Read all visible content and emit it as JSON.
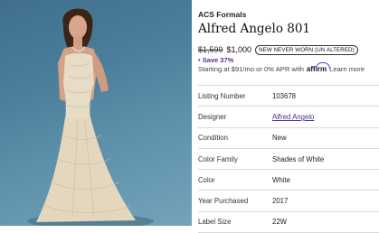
{
  "photo": {
    "alt": "wedding-dress-photo"
  },
  "listing": {
    "brand": "ACS Formals",
    "title": "Alfred Angelo 801",
    "original_price": "$1,599",
    "price": "$1,000",
    "condition_badge": "NEW NEVER WORN (UN ALTERED)",
    "savings": "• Save 37%",
    "financing_prefix": "Starting at $91/mo or 0% APR with",
    "affirm_label": "affirm",
    "learn_more": "Learn more"
  },
  "details": [
    {
      "label": "Listing Number",
      "value": "103678",
      "link": false
    },
    {
      "label": "Designer",
      "value": "Alfred Angelo",
      "link": true
    },
    {
      "label": "Condition",
      "value": "New",
      "link": false
    },
    {
      "label": "Color Family",
      "value": "Shades of White",
      "link": false
    },
    {
      "label": "Color",
      "value": "White",
      "link": false
    },
    {
      "label": "Year Purchased",
      "value": "2017",
      "link": false
    },
    {
      "label": "Label Size",
      "value": "22W",
      "link": false
    }
  ],
  "colors": {
    "accent": "#5b2a86",
    "link": "#4d2b8a",
    "photo_bg": "#4c7f9c"
  }
}
